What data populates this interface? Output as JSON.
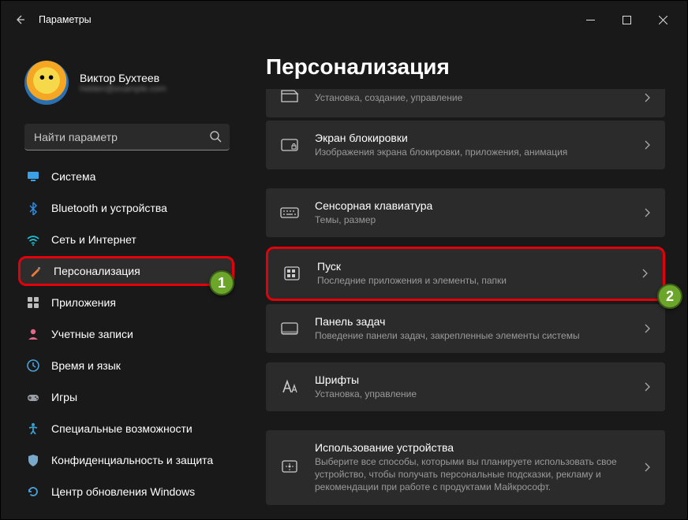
{
  "titlebar": {
    "back_aria": "Назад",
    "title": "Параметры"
  },
  "user": {
    "name": "Виктор Бухтеев",
    "email": "hidden@example.com"
  },
  "search": {
    "placeholder": "Найти параметр"
  },
  "sidebar": {
    "items": [
      {
        "label": "Система",
        "icon": "monitor",
        "color": "#3ca0e7"
      },
      {
        "label": "Bluetooth и устройства",
        "icon": "bluetooth",
        "color": "#2f8ae0"
      },
      {
        "label": "Сеть и Интернет",
        "icon": "wifi",
        "color": "#19c3d6"
      },
      {
        "label": "Персонализация",
        "icon": "brush",
        "color": "#e77a3c",
        "active": true,
        "highlight": true
      },
      {
        "label": "Приложения",
        "icon": "apps",
        "color": "#bbb"
      },
      {
        "label": "Учетные записи",
        "icon": "user",
        "color": "#e06a8a"
      },
      {
        "label": "Время и язык",
        "icon": "clock",
        "color": "#4aa0d8"
      },
      {
        "label": "Игры",
        "icon": "game",
        "color": "#9aa0a6"
      },
      {
        "label": "Специальные возможности",
        "icon": "access",
        "color": "#3aa0d0"
      },
      {
        "label": "Конфиденциальность и защита",
        "icon": "shield",
        "color": "#7aa8c8"
      },
      {
        "label": "Центр обновления Windows",
        "icon": "update",
        "color": "#4aa0d8"
      }
    ]
  },
  "main": {
    "title": "Персонализация",
    "items": [
      {
        "title": "",
        "sub": "Установка, создание, управление",
        "icon": "theme",
        "partial": true
      },
      {
        "title": "Экран блокировки",
        "sub": "Изображения экрана блокировки, приложения, анимация",
        "icon": "lock"
      },
      {
        "title": "Сенсорная клавиатура",
        "sub": "Темы, размер",
        "icon": "keyboard"
      },
      {
        "title": "Пуск",
        "sub": "Последние приложения и элементы, папки",
        "icon": "start",
        "highlight": true
      },
      {
        "title": "Панель задач",
        "sub": "Поведение панели задач, закрепленные элементы системы",
        "icon": "taskbar"
      },
      {
        "title": "Шрифты",
        "sub": "Установка, управление",
        "icon": "font"
      },
      {
        "title": "Использование устройства",
        "sub": "Выберите все способы, которыми вы планируете использовать свое устройство, чтобы получать персональные подсказки, рекламу и рекомендации при работе с продуктами Майкрософт.",
        "icon": "usage"
      }
    ]
  },
  "badges": {
    "one": "1",
    "two": "2"
  }
}
